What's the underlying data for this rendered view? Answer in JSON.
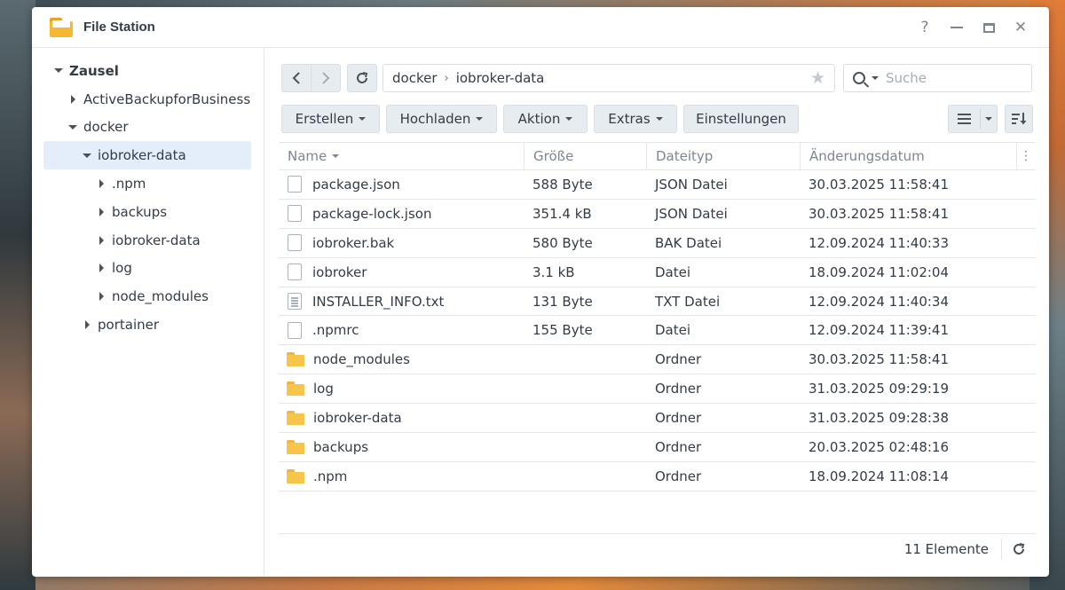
{
  "window": {
    "title": "File Station",
    "help": "?",
    "close": "✕"
  },
  "sidebar": {
    "items": [
      {
        "label": "Zausel",
        "level": 0,
        "expanded": true
      },
      {
        "label": "ActiveBackupforBusiness",
        "level": 1,
        "expanded": false
      },
      {
        "label": "docker",
        "level": 1,
        "expanded": true
      },
      {
        "label": "iobroker-data",
        "level": 2,
        "expanded": true,
        "selected": true
      },
      {
        "label": ".npm",
        "level": 3,
        "expanded": false
      },
      {
        "label": "backups",
        "level": 3,
        "expanded": false
      },
      {
        "label": "iobroker-data",
        "level": 3,
        "expanded": false
      },
      {
        "label": "log",
        "level": 3,
        "expanded": false
      },
      {
        "label": "node_modules",
        "level": 3,
        "expanded": false
      },
      {
        "label": "portainer",
        "level": 2,
        "expanded": false
      }
    ]
  },
  "pathbar": {
    "segments": [
      "docker",
      "iobroker-data"
    ],
    "separator": "›",
    "star": "★"
  },
  "search": {
    "placeholder": "Suche"
  },
  "toolbar": {
    "create": "Erstellen",
    "upload": "Hochladen",
    "action": "Aktion",
    "extras": "Extras",
    "settings": "Einstellungen"
  },
  "table": {
    "headers": {
      "name": "Name",
      "size": "Größe",
      "type": "Dateityp",
      "date": "Änderungsdatum"
    },
    "rows": [
      {
        "name": "package.json",
        "size": "588 Byte",
        "type": "JSON Datei",
        "date": "30.03.2025 11:58:41",
        "icon": "file"
      },
      {
        "name": "package-lock.json",
        "size": "351.4 kB",
        "type": "JSON Datei",
        "date": "30.03.2025 11:58:41",
        "icon": "file"
      },
      {
        "name": "iobroker.bak",
        "size": "580 Byte",
        "type": "BAK Datei",
        "date": "12.09.2024 11:40:33",
        "icon": "file"
      },
      {
        "name": "iobroker",
        "size": "3.1 kB",
        "type": "Datei",
        "date": "18.09.2024 11:02:04",
        "icon": "file"
      },
      {
        "name": "INSTALLER_INFO.txt",
        "size": "131 Byte",
        "type": "TXT Datei",
        "date": "12.09.2024 11:40:34",
        "icon": "txt"
      },
      {
        "name": ".npmrc",
        "size": "155 Byte",
        "type": "Datei",
        "date": "12.09.2024 11:39:41",
        "icon": "file"
      },
      {
        "name": "node_modules",
        "size": "",
        "type": "Ordner",
        "date": "30.03.2025 11:58:41",
        "icon": "folder"
      },
      {
        "name": "log",
        "size": "",
        "type": "Ordner",
        "date": "31.03.2025 09:29:19",
        "icon": "folder"
      },
      {
        "name": "iobroker-data",
        "size": "",
        "type": "Ordner",
        "date": "31.03.2025 09:28:38",
        "icon": "folder"
      },
      {
        "name": "backups",
        "size": "",
        "type": "Ordner",
        "date": "20.03.2025 02:48:16",
        "icon": "folder"
      },
      {
        "name": ".npm",
        "size": "",
        "type": "Ordner",
        "date": "18.09.2024 11:08:14",
        "icon": "folder"
      }
    ]
  },
  "footer": {
    "count": "11 Elemente"
  },
  "colors": {
    "accent_selected": "#e3eefa",
    "folder": "#f7c54a",
    "button_bg": "#e7ecf0",
    "text": "#333c45"
  }
}
